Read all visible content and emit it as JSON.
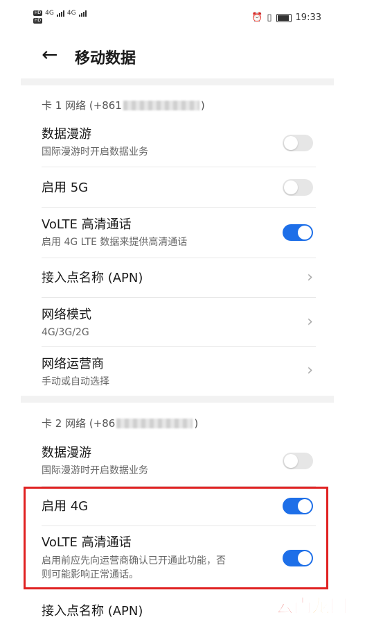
{
  "status_bar": {
    "time": "19:33",
    "left_sim1": "4G",
    "left_sim2": "4G",
    "hd_label": "HD"
  },
  "header": {
    "title": "移动数据"
  },
  "sim1": {
    "section_label_prefix": "卡 1 网络 (+861",
    "section_label_suffix": ")",
    "rows": [
      {
        "title": "数据漫游",
        "subtitle": "国际漫游时开启数据业务",
        "control": "toggle",
        "on": false
      },
      {
        "title": "启用 5G",
        "subtitle": "",
        "control": "toggle",
        "on": false
      },
      {
        "title": "VoLTE 高清通话",
        "subtitle": "启用 4G LTE 数据来提供高清通话",
        "control": "toggle",
        "on": true
      },
      {
        "title": "接入点名称 (APN)",
        "subtitle": "",
        "control": "chevron"
      },
      {
        "title": "网络模式",
        "subtitle": "4G/3G/2G",
        "control": "chevron"
      },
      {
        "title": "网络运营商",
        "subtitle": "手动或自动选择",
        "control": "chevron"
      }
    ]
  },
  "sim2": {
    "section_label_prefix": "卡 2 网络 (+86",
    "section_label_suffix": ")",
    "rows": [
      {
        "title": "数据漫游",
        "subtitle": "国际漫游时开启数据业务",
        "control": "toggle",
        "on": false
      },
      {
        "title": "启用 4G",
        "subtitle": "",
        "control": "toggle",
        "on": true
      },
      {
        "title": "VoLTE 高清通话",
        "subtitle_line1": "启用前应先向运营商确认已开通此功能，否",
        "subtitle_line2": "则可能影响正常通话。",
        "control": "toggle",
        "on": true
      },
      {
        "title": "接入点名称 (APN)",
        "subtitle": "",
        "control": "chevron"
      }
    ]
  },
  "watermark": {
    "c1": "云",
    "c2": "南",
    "c3": "龙",
    "c4": "网",
    "colors": [
      "#e0231a",
      "#e0231a",
      "#f39c12",
      "#e0231a"
    ]
  },
  "colors": {
    "accent": "#1e6fe8",
    "highlight_border": "#e02222"
  }
}
